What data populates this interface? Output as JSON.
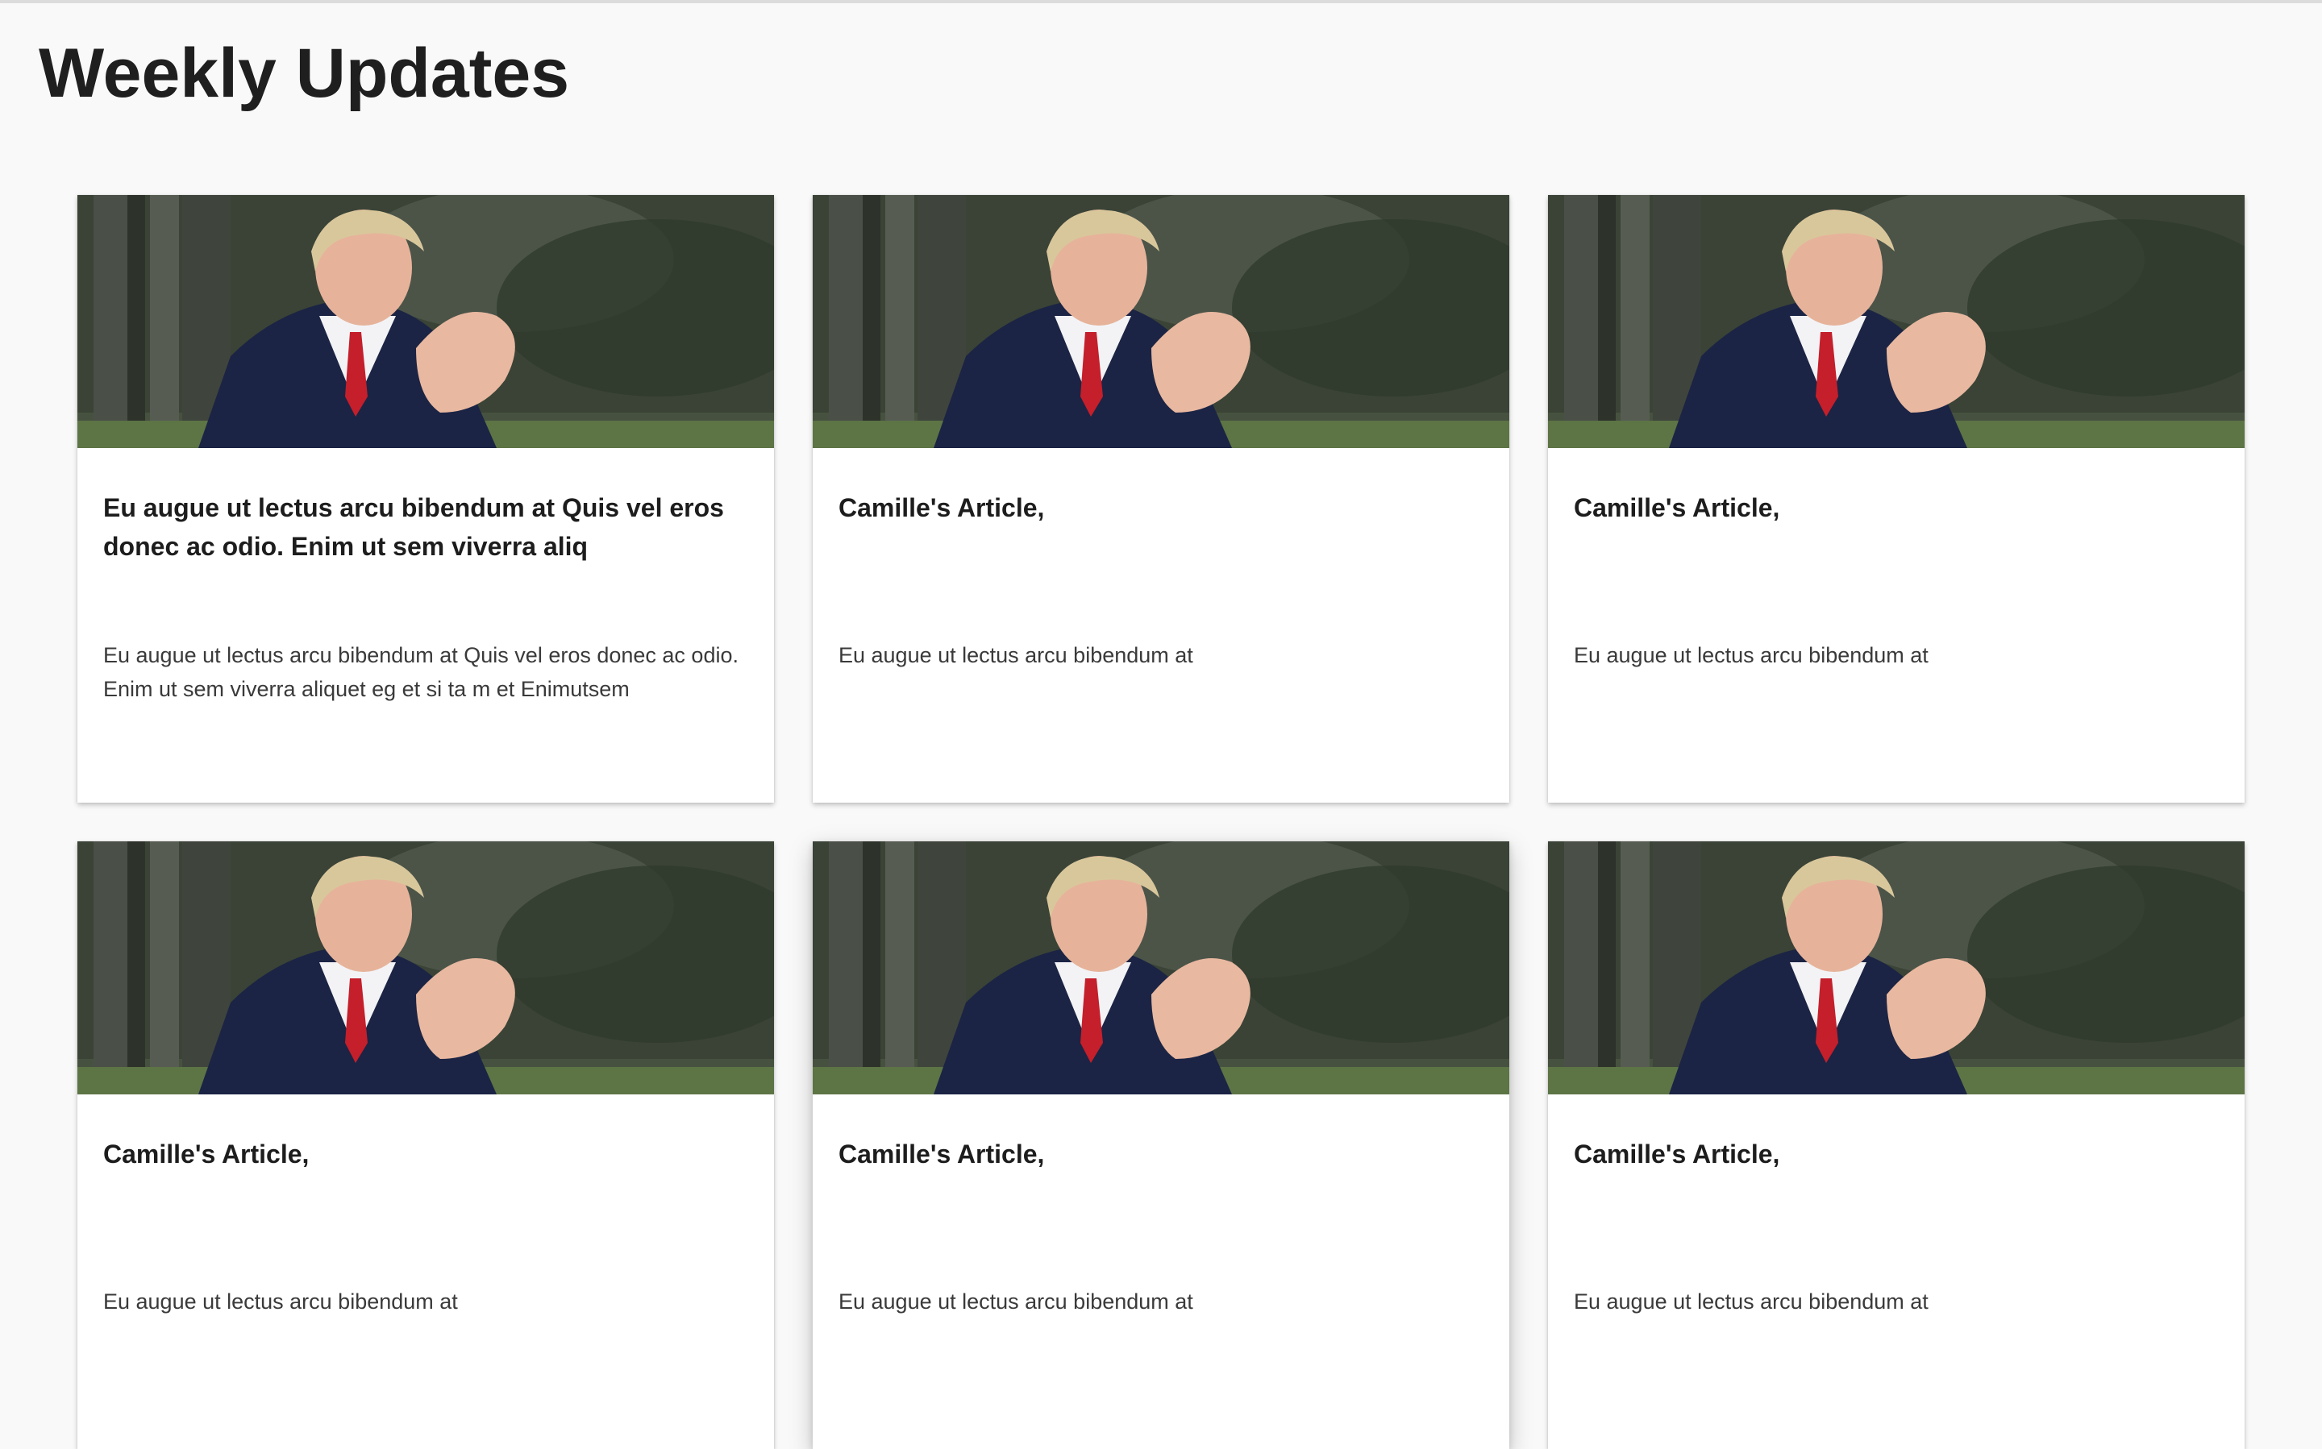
{
  "page": {
    "title": "Weekly Updates"
  },
  "colors": {
    "background": "#f9f9f9",
    "card_background": "#ffffff",
    "title_text": "#1f1f1f",
    "body_text": "#3a3a3a"
  },
  "cards": [
    {
      "image_alt": "photo-of-man-in-suit",
      "title": "Eu augue ut lectus arcu bibendum at Quis vel eros donec ac odio. Enim ut sem viverra aliq",
      "description": "Eu augue ut lectus arcu bibendum at Quis vel eros donec ac odio. Enim ut sem viverra aliquet eg et si ta m et Enimutsem"
    },
    {
      "image_alt": "photo-of-man-in-suit",
      "title": "Camille's Article,",
      "description": "Eu augue ut lectus arcu bibendum at"
    },
    {
      "image_alt": "photo-of-man-in-suit",
      "title": "Camille's Article,",
      "description": "Eu augue ut lectus arcu bibendum at"
    },
    {
      "image_alt": "photo-of-man-in-suit",
      "title": "Camille's Article,",
      "description": "Eu augue ut lectus arcu bibendum at"
    },
    {
      "image_alt": "photo-of-man-in-suit",
      "title": "Camille's Article,",
      "description": "Eu augue ut lectus arcu bibendum at"
    },
    {
      "image_alt": "photo-of-man-in-suit",
      "title": "Camille's Article,",
      "description": "Eu augue ut lectus arcu bibendum at"
    }
  ]
}
